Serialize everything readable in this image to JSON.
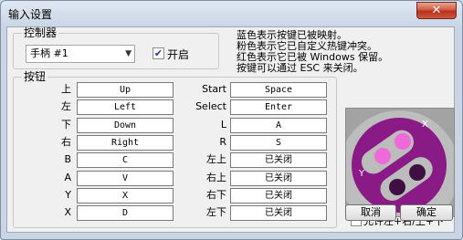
{
  "window": {
    "title": "输入设置",
    "close_label": "✕"
  },
  "controller": {
    "group_label": "控制器",
    "selected": "手柄 #1",
    "enable_checked": true,
    "enable_label": "开启"
  },
  "info": {
    "line1": "蓝色表示按键已被映射。",
    "line2": "粉色表示它已自定义热键冲突。",
    "line3": "红色表示它已被 Windows 保留。",
    "line4": "按键可以通过 ESC 来关闭。"
  },
  "buttons_group": {
    "label": "按钮",
    "left": [
      {
        "label": "上",
        "value": "Up"
      },
      {
        "label": "左",
        "value": "Left"
      },
      {
        "label": "下",
        "value": "Down"
      },
      {
        "label": "右",
        "value": "Right"
      },
      {
        "label": "B",
        "value": "C"
      },
      {
        "label": "A",
        "value": "V"
      },
      {
        "label": "Y",
        "value": "X"
      },
      {
        "label": "X",
        "value": "D"
      }
    ],
    "right": [
      {
        "label": "Start",
        "value": "Space"
      },
      {
        "label": "Select",
        "value": "Enter"
      },
      {
        "label": "L",
        "value": "A"
      },
      {
        "label": "R",
        "value": "S"
      },
      {
        "label": "左上",
        "value": "已关闭"
      },
      {
        "label": "右上",
        "value": "已关闭"
      },
      {
        "label": "右下",
        "value": "已关闭"
      },
      {
        "label": "左下",
        "value": "已关闭"
      }
    ]
  },
  "preview": {
    "x_label": "X",
    "y_label": "Y"
  },
  "allow_diagonal": {
    "label": "允许左+右/上+下",
    "checked": false
  },
  "actions": {
    "cancel": "取消",
    "ok": "确定"
  },
  "colors": {
    "pad_purple": "#8a1a86",
    "highlight_pink": "#ee6ad8",
    "pad_gray": "#b9b9b9"
  }
}
